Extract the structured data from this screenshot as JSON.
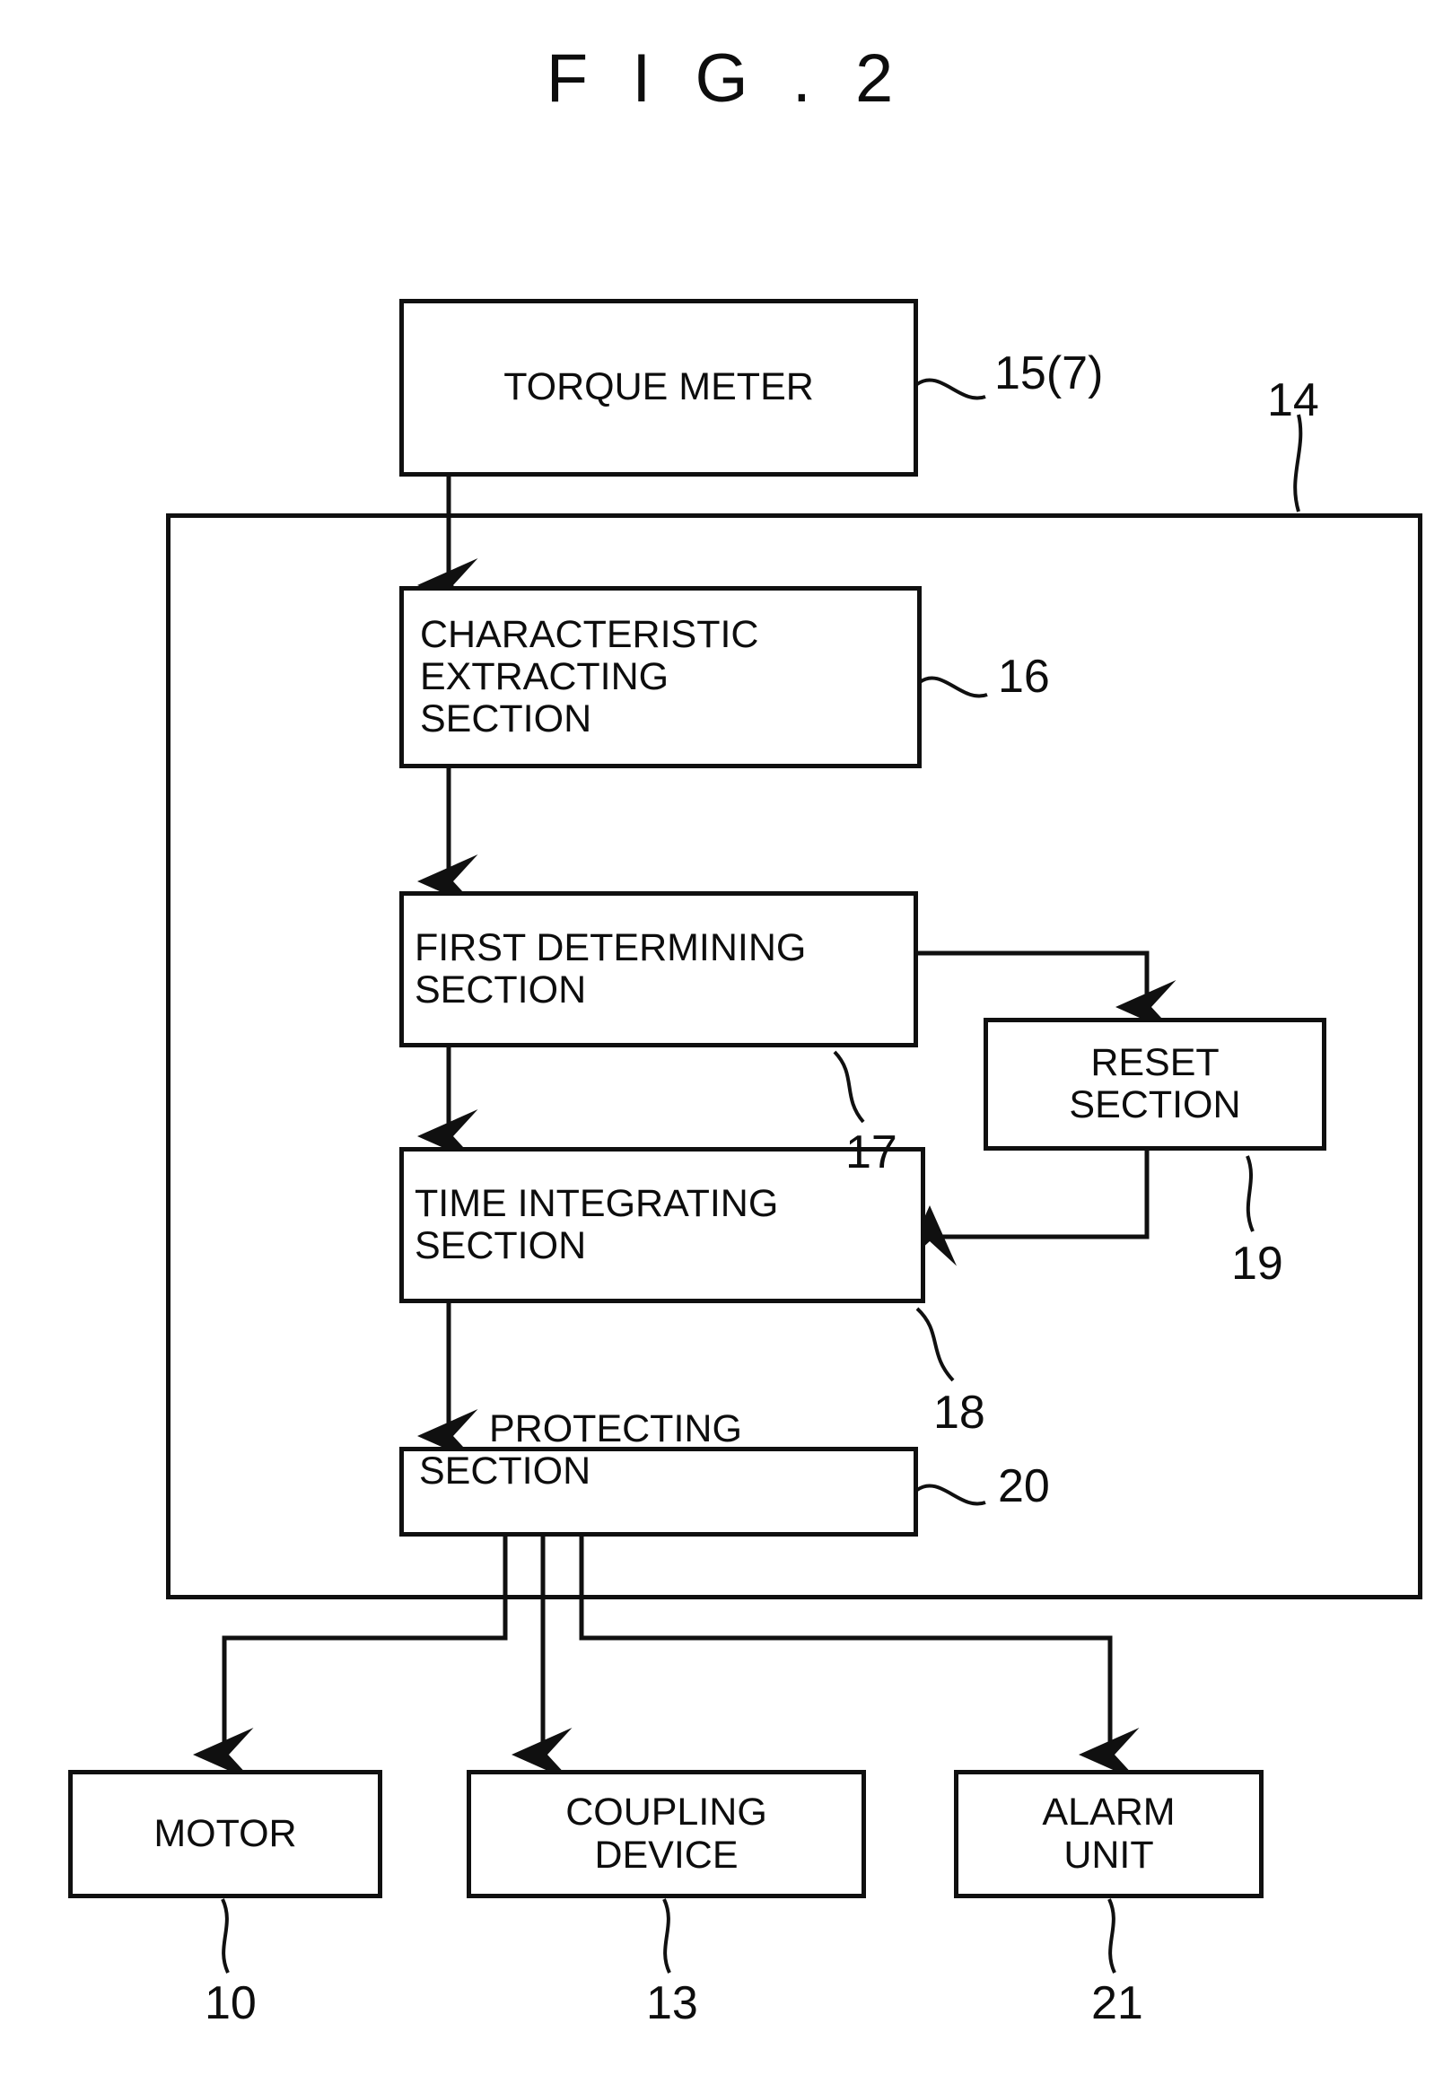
{
  "figure": {
    "title": "F I G . 2",
    "type": "block-diagram",
    "background_color": "#ffffff",
    "line_color": "#101010"
  },
  "blocks": {
    "torque_meter": {
      "lines": [
        "TORQUE METER"
      ],
      "ref": "15(7)"
    },
    "characteristic_extracting": {
      "lines": [
        "CHARACTERISTIC",
        "EXTRACTING",
        "SECTION"
      ],
      "ref": "16"
    },
    "first_determining": {
      "lines": [
        "FIRST DETERMINING",
        "SECTION"
      ],
      "ref": "17"
    },
    "reset": {
      "lines": [
        "RESET",
        "SECTION"
      ],
      "ref": "19"
    },
    "time_integrating": {
      "lines": [
        "TIME INTEGRATING",
        "SECTION"
      ],
      "ref": "18"
    },
    "protecting": {
      "lines": [
        "PROTECTING",
        "SECTION"
      ],
      "ref": "20"
    },
    "motor": {
      "lines": [
        "MOTOR"
      ],
      "ref": "10"
    },
    "coupling_device": {
      "lines": [
        "COUPLING",
        "DEVICE"
      ],
      "ref": "13"
    },
    "alarm_unit": {
      "lines": [
        "ALARM",
        "UNIT"
      ],
      "ref": "21"
    }
  },
  "enclosure": {
    "ref": "14"
  },
  "refs": {
    "r15_7": "15(7)",
    "r14": "14",
    "r16": "16",
    "r17": "17",
    "r19": "19",
    "r18": "18",
    "r20": "20",
    "r10": "10",
    "r13": "13",
    "r21": "21"
  },
  "text": {
    "torque_meter_l1": "TORQUE METER",
    "characteristic_l1": "CHARACTERISTIC",
    "characteristic_l2": "EXTRACTING",
    "characteristic_l3": "SECTION",
    "first_determining_l1": "FIRST DETERMINING",
    "first_determining_l2": "SECTION",
    "reset_l1": "RESET",
    "reset_l2": "SECTION",
    "time_integrating_l1": "TIME INTEGRATING",
    "time_integrating_l2": "SECTION",
    "protecting_l1": "PROTECTING",
    "protecting_l2": "SECTION",
    "motor_l1": "MOTOR",
    "coupling_l1": "COUPLING",
    "coupling_l2": "DEVICE",
    "alarm_l1": "ALARM",
    "alarm_l2": "UNIT"
  }
}
